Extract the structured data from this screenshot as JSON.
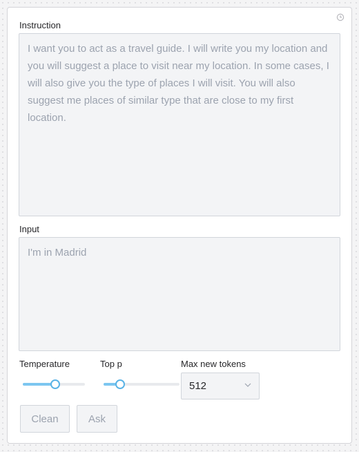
{
  "instruction": {
    "label": "Instruction",
    "placeholder": "I want you to act as a travel guide. I will write you my location and you will suggest a place to visit near my location. In some cases, I will also give you the type of places I will visit. You will also suggest me places of similar type that are close to my first location."
  },
  "input": {
    "label": "Input",
    "placeholder": "I'm in Madrid"
  },
  "temperature": {
    "label": "Temperature",
    "value_fraction": 0.52
  },
  "top_p": {
    "label": "Top p",
    "value_fraction": 0.22
  },
  "max_new_tokens": {
    "label": "Max new tokens",
    "value": "512"
  },
  "buttons": {
    "clean": "Clean",
    "ask": "Ask"
  },
  "icons": {
    "corner": "clock-icon",
    "select": "chevron-down-icon"
  },
  "colors": {
    "slider_accent": "#7cc6f0",
    "field_background": "#f3f4f6",
    "placeholder_text": "#9ca3af"
  }
}
